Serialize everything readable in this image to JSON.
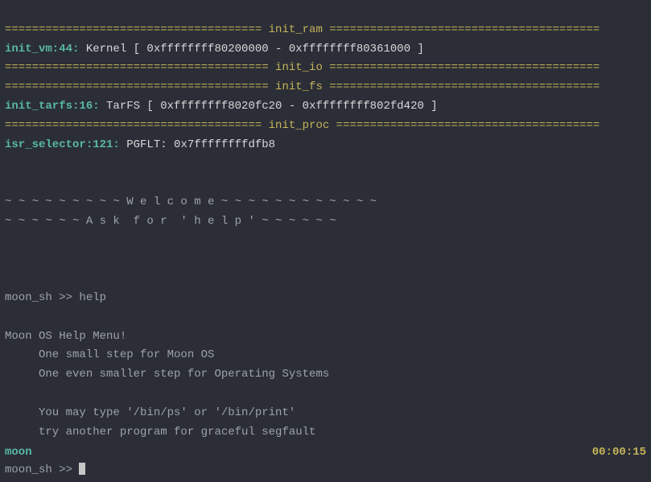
{
  "dividers": {
    "init_ram": "====================================== init_ram ========================================",
    "init_io": "======================================= init_io ========================================",
    "init_fs": "======================================= init_fs ========================================",
    "init_proc": "====================================== init_proc ======================================="
  },
  "logs": {
    "init_vm": {
      "prefix": "init_vm:44:",
      "text": " Kernel [ 0xffffffff80200000 - 0xffffffff80361000 ]"
    },
    "init_tarfs": {
      "prefix": "init_tarfs:16:",
      "text": " TarFS [ 0xffffffff8020fc20 - 0xffffffff802fd420 ]"
    },
    "isr": {
      "prefix": "isr_selector:121:",
      "text": " PGFLT: 0x7ffffffffdfb8"
    }
  },
  "welcome": {
    "line1": "~ ~ ~ ~ ~ ~ ~ ~ ~ W e l c o m e ~ ~ ~ ~ ~ ~ ~ ~ ~ ~ ~ ~",
    "line2": "~ ~ ~ ~ ~ ~ A s k  f o r  ' h e l p ' ~ ~ ~ ~ ~ ~"
  },
  "shell": {
    "prompt1": "moon_sh >> ",
    "cmd1": "help",
    "prompt2": "moon_sh >> "
  },
  "help": {
    "title": "Moon OS Help Menu!",
    "l1": "     One small step for Moon OS",
    "l2": "     One even smaller step for Operating Systems",
    "l3": "     You may type '/bin/ps' or '/bin/print'",
    "l4": "     try another program for graceful segfault"
  },
  "status": {
    "name": "moon",
    "clock": "00:00:15"
  }
}
